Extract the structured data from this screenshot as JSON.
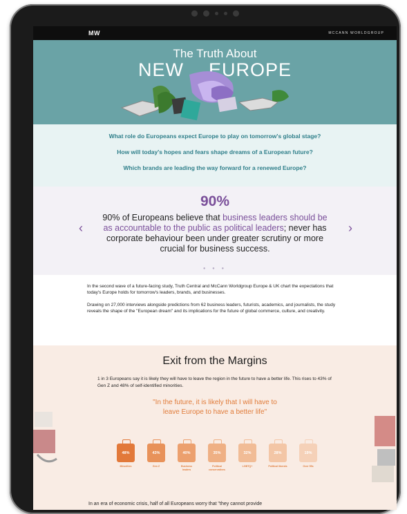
{
  "topbar": {
    "logo": "MW",
    "brand": "MCCANN WORLDGROUP"
  },
  "hero": {
    "title_line1": "The Truth About",
    "title_word1": "NEW",
    "title_word2": "EUROPE"
  },
  "questions": [
    "What role do Europeans expect Europe to play on tomorrow's global stage?",
    "How will today's hopes and fears shape dreams of a European future?",
    "Which brands are leading the way forward for a renewed Europe?"
  ],
  "stat": {
    "value": "90%",
    "text_before": "90% of Europeans believe that ",
    "highlight": "business leaders should be as accountable to the public as political leaders",
    "text_after": "; never has corporate behaviour been under greater scrutiny or more crucial for business success.",
    "dots": "● ● ●"
  },
  "intro": {
    "p1": "In the second wave of a future-facing study, Truth Central and McCann Worldgroup Europe & UK chart the expectations that today's Europe holds for tomorrow's leaders, brands, and businesses.",
    "p2": "Drawing on 27,000 interviews alongside predictions from 62 business leaders, futurists, academics, and journalists, the study reveals the shape of the \"European dream\" and its implications for the future of global commerce, culture, and creativity."
  },
  "margins": {
    "title": "Exit from the Margins",
    "desc": "1 in 3 Europeans say it is likely they will have to leave the region in the future to have a better life. This rises to 43% of Gen Z and 48% of self-identified minorities.",
    "quote_line1": "\"In the future, it is likely that I will have to",
    "quote_line2": "leave Europe to have a better life\"",
    "cases": [
      {
        "value": "48%",
        "label": "Minorities",
        "color": "#e2793a"
      },
      {
        "value": "43%",
        "label": "Gen Z",
        "color": "#e8925a"
      },
      {
        "value": "40%",
        "label": "Business leaders",
        "color": "#eca06e"
      },
      {
        "value": "35%",
        "label": "Political conservatives",
        "color": "#efb084"
      },
      {
        "value": "32%",
        "label": "LGBTQ+",
        "color": "#f1bc96"
      },
      {
        "value": "28%",
        "label": "Political liberals",
        "color": "#f3c6a6"
      },
      {
        "value": "19%",
        "label": "Over 55s",
        "color": "#f5d1b8"
      }
    ],
    "bottom": "In an era of economic crisis, half of all Europeans worry that \"they cannot provide"
  }
}
